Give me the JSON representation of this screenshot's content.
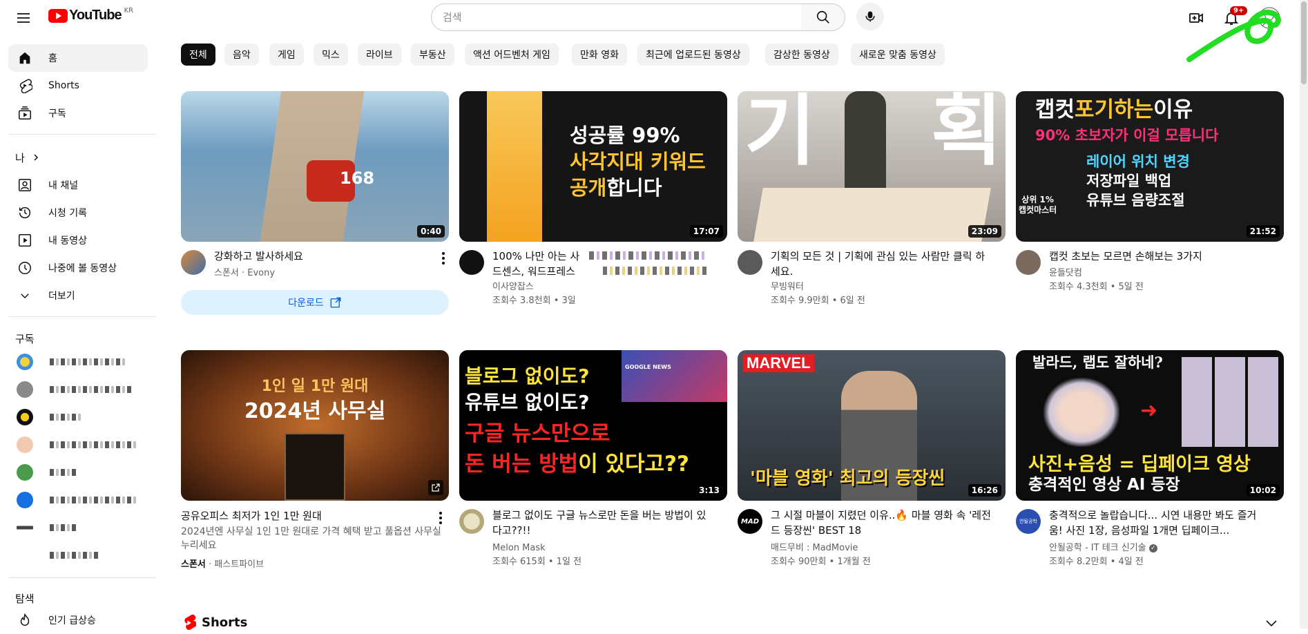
{
  "header": {
    "logo_text": "YouTube",
    "region": "KR",
    "search_placeholder": "검색",
    "notification_count": "9+"
  },
  "sidebar": {
    "main": [
      {
        "label": "홈",
        "icon": "home-icon"
      },
      {
        "label": "Shorts",
        "icon": "shorts-icon"
      },
      {
        "label": "구독",
        "icon": "subscriptions-icon"
      }
    ],
    "you_heading": "나",
    "you_items": [
      {
        "label": "내 채널",
        "icon": "channel-icon"
      },
      {
        "label": "시청 기록",
        "icon": "history-icon"
      },
      {
        "label": "내 동영상",
        "icon": "my-videos-icon"
      },
      {
        "label": "나중에 볼 동영상",
        "icon": "watch-later-icon"
      },
      {
        "label": "더보기",
        "icon": "chevron-down-icon"
      }
    ],
    "subscriptions_heading": "구독",
    "explore_heading": "탐색",
    "explore_items": [
      {
        "label": "인기 급상승",
        "icon": "trending-icon"
      }
    ]
  },
  "chips": [
    "전체",
    "음악",
    "게임",
    "믹스",
    "라이브",
    "부동산",
    "액션 어드벤처 게임",
    "만화 영화",
    "최근에 업로드된 동영상",
    "감상한 동영상",
    "새로운 맞춤 동영상"
  ],
  "row1": [
    {
      "title": "강화하고 발사하세요",
      "line2": "스폰서 · Evony",
      "line3": "",
      "duration": "0:40",
      "ad": true,
      "download_label": "다운로드"
    },
    {
      "title": "100% 나만 아는 사",
      "title2": "드센스, 워드프레스",
      "channel": "이사양잡스",
      "views": "조회수 3.8천회 • 3일",
      "duration": "17:07",
      "thumb_line1": "성공률 99%",
      "thumb_line2": "사각지대 키워드",
      "thumb_line3a": "공개",
      "thumb_line3b": "합니다"
    },
    {
      "title": "기획의 모든 것 | 기획에 관심 있는 사람만 클릭 하세요.",
      "channel": "무빙워터",
      "views": "조회수 9.9만회 • 6일 전",
      "duration": "23:09",
      "thumb_left": "기",
      "thumb_right": "획"
    },
    {
      "title": "캡컷 초보는 모르면 손해보는 3가지",
      "channel": "윤들닷컴",
      "views": "조회수 4.3천회 • 5일 전",
      "duration": "21:52",
      "thumb_t1a": "캡컷",
      "thumb_t1b": "포기하는",
      "thumb_t1c": "이유",
      "thumb_t2": "90% 초보자가 이걸 모릅니다",
      "thumb_t3": "레이어 위치 변경",
      "thumb_t4": "저장파일 백업",
      "thumb_t5": "유튜브 음량조절",
      "thumb_badge1": "상위 1%",
      "thumb_badge2": "캡컷마스터"
    }
  ],
  "row2": [
    {
      "title": "공유오피스 최저가 1인 1만 원대",
      "desc": "2024년엔 사무실 1인 1만 원대로 가격 혜택 받고 풀옵션 사무실 누리세요",
      "sponsor_label": "스폰서",
      "sponsor_name": "패스트파이브",
      "thumb_line1": "1인 일 1만 원대",
      "thumb_line2": "2024년 사무실"
    },
    {
      "title": "블로그 없이도 구글 뉴스로만 돈을 버는 방법이 있다고??!!",
      "channel": "Melon Mask",
      "views": "조회수 615회 • 1일 전",
      "duration": "3:13",
      "thumb_l1": "블로그 없이도?",
      "thumb_l2": "유튜브 없이도?",
      "thumb_l3": "구글 뉴스만으로",
      "thumb_l4a": "돈 버는 방법",
      "thumb_l4b": "이 있다고??",
      "thumb_news": "GOOGLE NEWS"
    },
    {
      "title": "그 시절 마블이 지렸던 이유..🔥 마블 영화 속 '레전드 등장씬' BEST 18",
      "channel": "매드무비 : MadMovie",
      "views": "조회수 90만회 • 1개월 전",
      "duration": "16:26",
      "thumb_brand": "MARVEL",
      "thumb_caption": "'마블 영화' 최고의 등장씬",
      "avatar_text": "MAD"
    },
    {
      "title": "충격적으로 놀랍습니다... 시연 내용만 봐도 즐거움! 사진 1장, 음성파일 1개면 딥페이크...",
      "channel": "안될공학 - IT 테크 신기술",
      "views": "조회수 8.2만회 • 4일 전",
      "duration": "10:02",
      "thumb_top": "발라드, 랩도 잘하네?",
      "thumb_b1": "사진+음성 = 딥페이크 영상",
      "thumb_b2": "충격적인 영상 AI 등장",
      "avatar_text": "안될공학"
    }
  ],
  "shorts_label": "Shorts",
  "colors": {
    "brand_red": "#ff0000",
    "chip_active": "#0f0f0f",
    "link_blue": "#065fd4",
    "annotation_green": "#22dd22"
  }
}
